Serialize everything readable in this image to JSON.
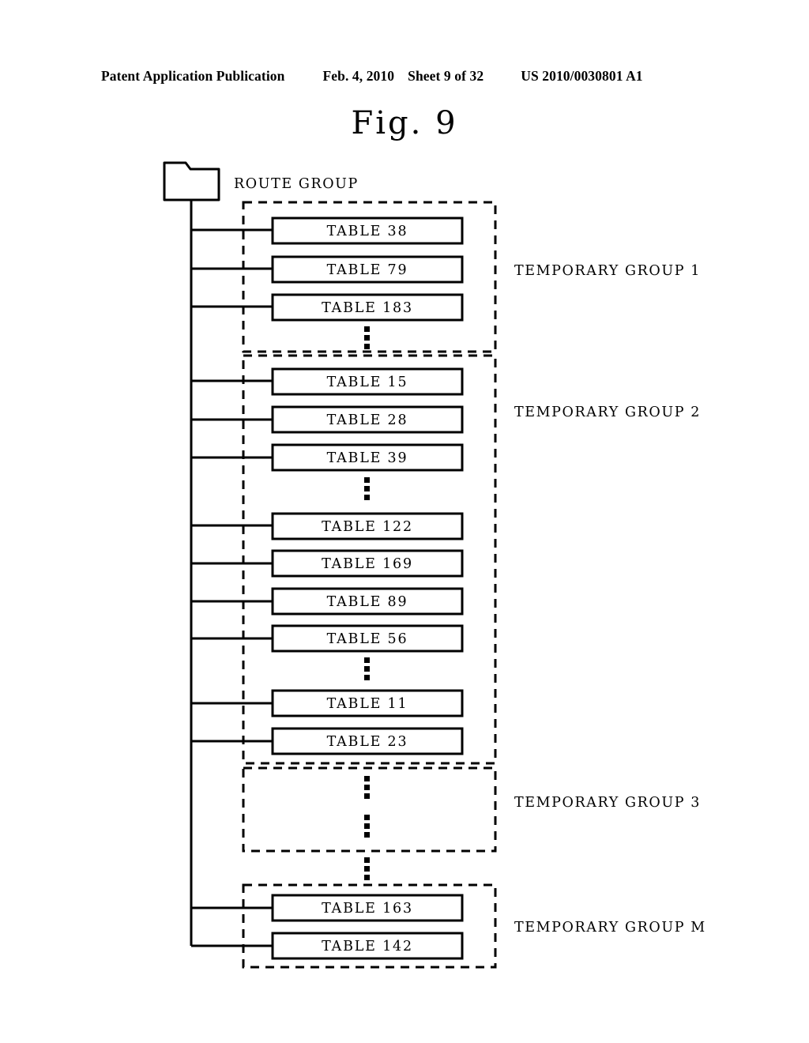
{
  "header": {
    "publication": "Patent Application Publication",
    "date": "Feb. 4, 2010",
    "sheet": "Sheet 9 of 32",
    "patent_number": "US 2010/0030801 A1"
  },
  "figure": {
    "title": "Fig. 9",
    "root_label": "ROUTE GROUP",
    "root_icon": "folder-icon",
    "line_color": "#000000",
    "background": "#ffffff"
  },
  "groups": [
    {
      "id": "group-1",
      "label": "TEMPORARY GROUP 1",
      "empty": false,
      "items": [
        {
          "label": "TABLE 38",
          "kind": "table"
        },
        {
          "label": "TABLE 79",
          "kind": "table"
        },
        {
          "label": "TABLE 183",
          "kind": "table"
        },
        {
          "label": "vertical-ellipsis",
          "kind": "ellipsis"
        }
      ]
    },
    {
      "id": "group-2",
      "label": "TEMPORARY GROUP 2",
      "empty": false,
      "items": [
        {
          "label": "TABLE 15",
          "kind": "table"
        },
        {
          "label": "TABLE 28",
          "kind": "table"
        },
        {
          "label": "TABLE 39",
          "kind": "table"
        },
        {
          "label": "vertical-ellipsis",
          "kind": "ellipsis"
        },
        {
          "label": "TABLE 122",
          "kind": "table"
        },
        {
          "label": "TABLE 169",
          "kind": "table"
        },
        {
          "label": "TABLE 89",
          "kind": "table"
        },
        {
          "label": "TABLE 56",
          "kind": "table"
        },
        {
          "label": "vertical-ellipsis",
          "kind": "ellipsis"
        },
        {
          "label": "TABLE 11",
          "kind": "table"
        },
        {
          "label": "TABLE 23",
          "kind": "table"
        }
      ]
    },
    {
      "id": "group-3",
      "label": "TEMPORARY GROUP 3",
      "empty": true,
      "items": [
        {
          "label": "vertical-ellipsis",
          "kind": "ellipsis"
        },
        {
          "label": "vertical-ellipsis",
          "kind": "ellipsis"
        }
      ]
    },
    {
      "id": "group-m",
      "label": "TEMPORARY GROUP M",
      "empty": false,
      "items": [
        {
          "label": "TABLE 163",
          "kind": "table"
        },
        {
          "label": "TABLE 142",
          "kind": "table"
        }
      ]
    }
  ],
  "between_group_ellipses": [
    {
      "after": "group-2",
      "label": "vertical-ellipsis"
    },
    {
      "after": "group-3",
      "label": "vertical-ellipsis"
    }
  ]
}
